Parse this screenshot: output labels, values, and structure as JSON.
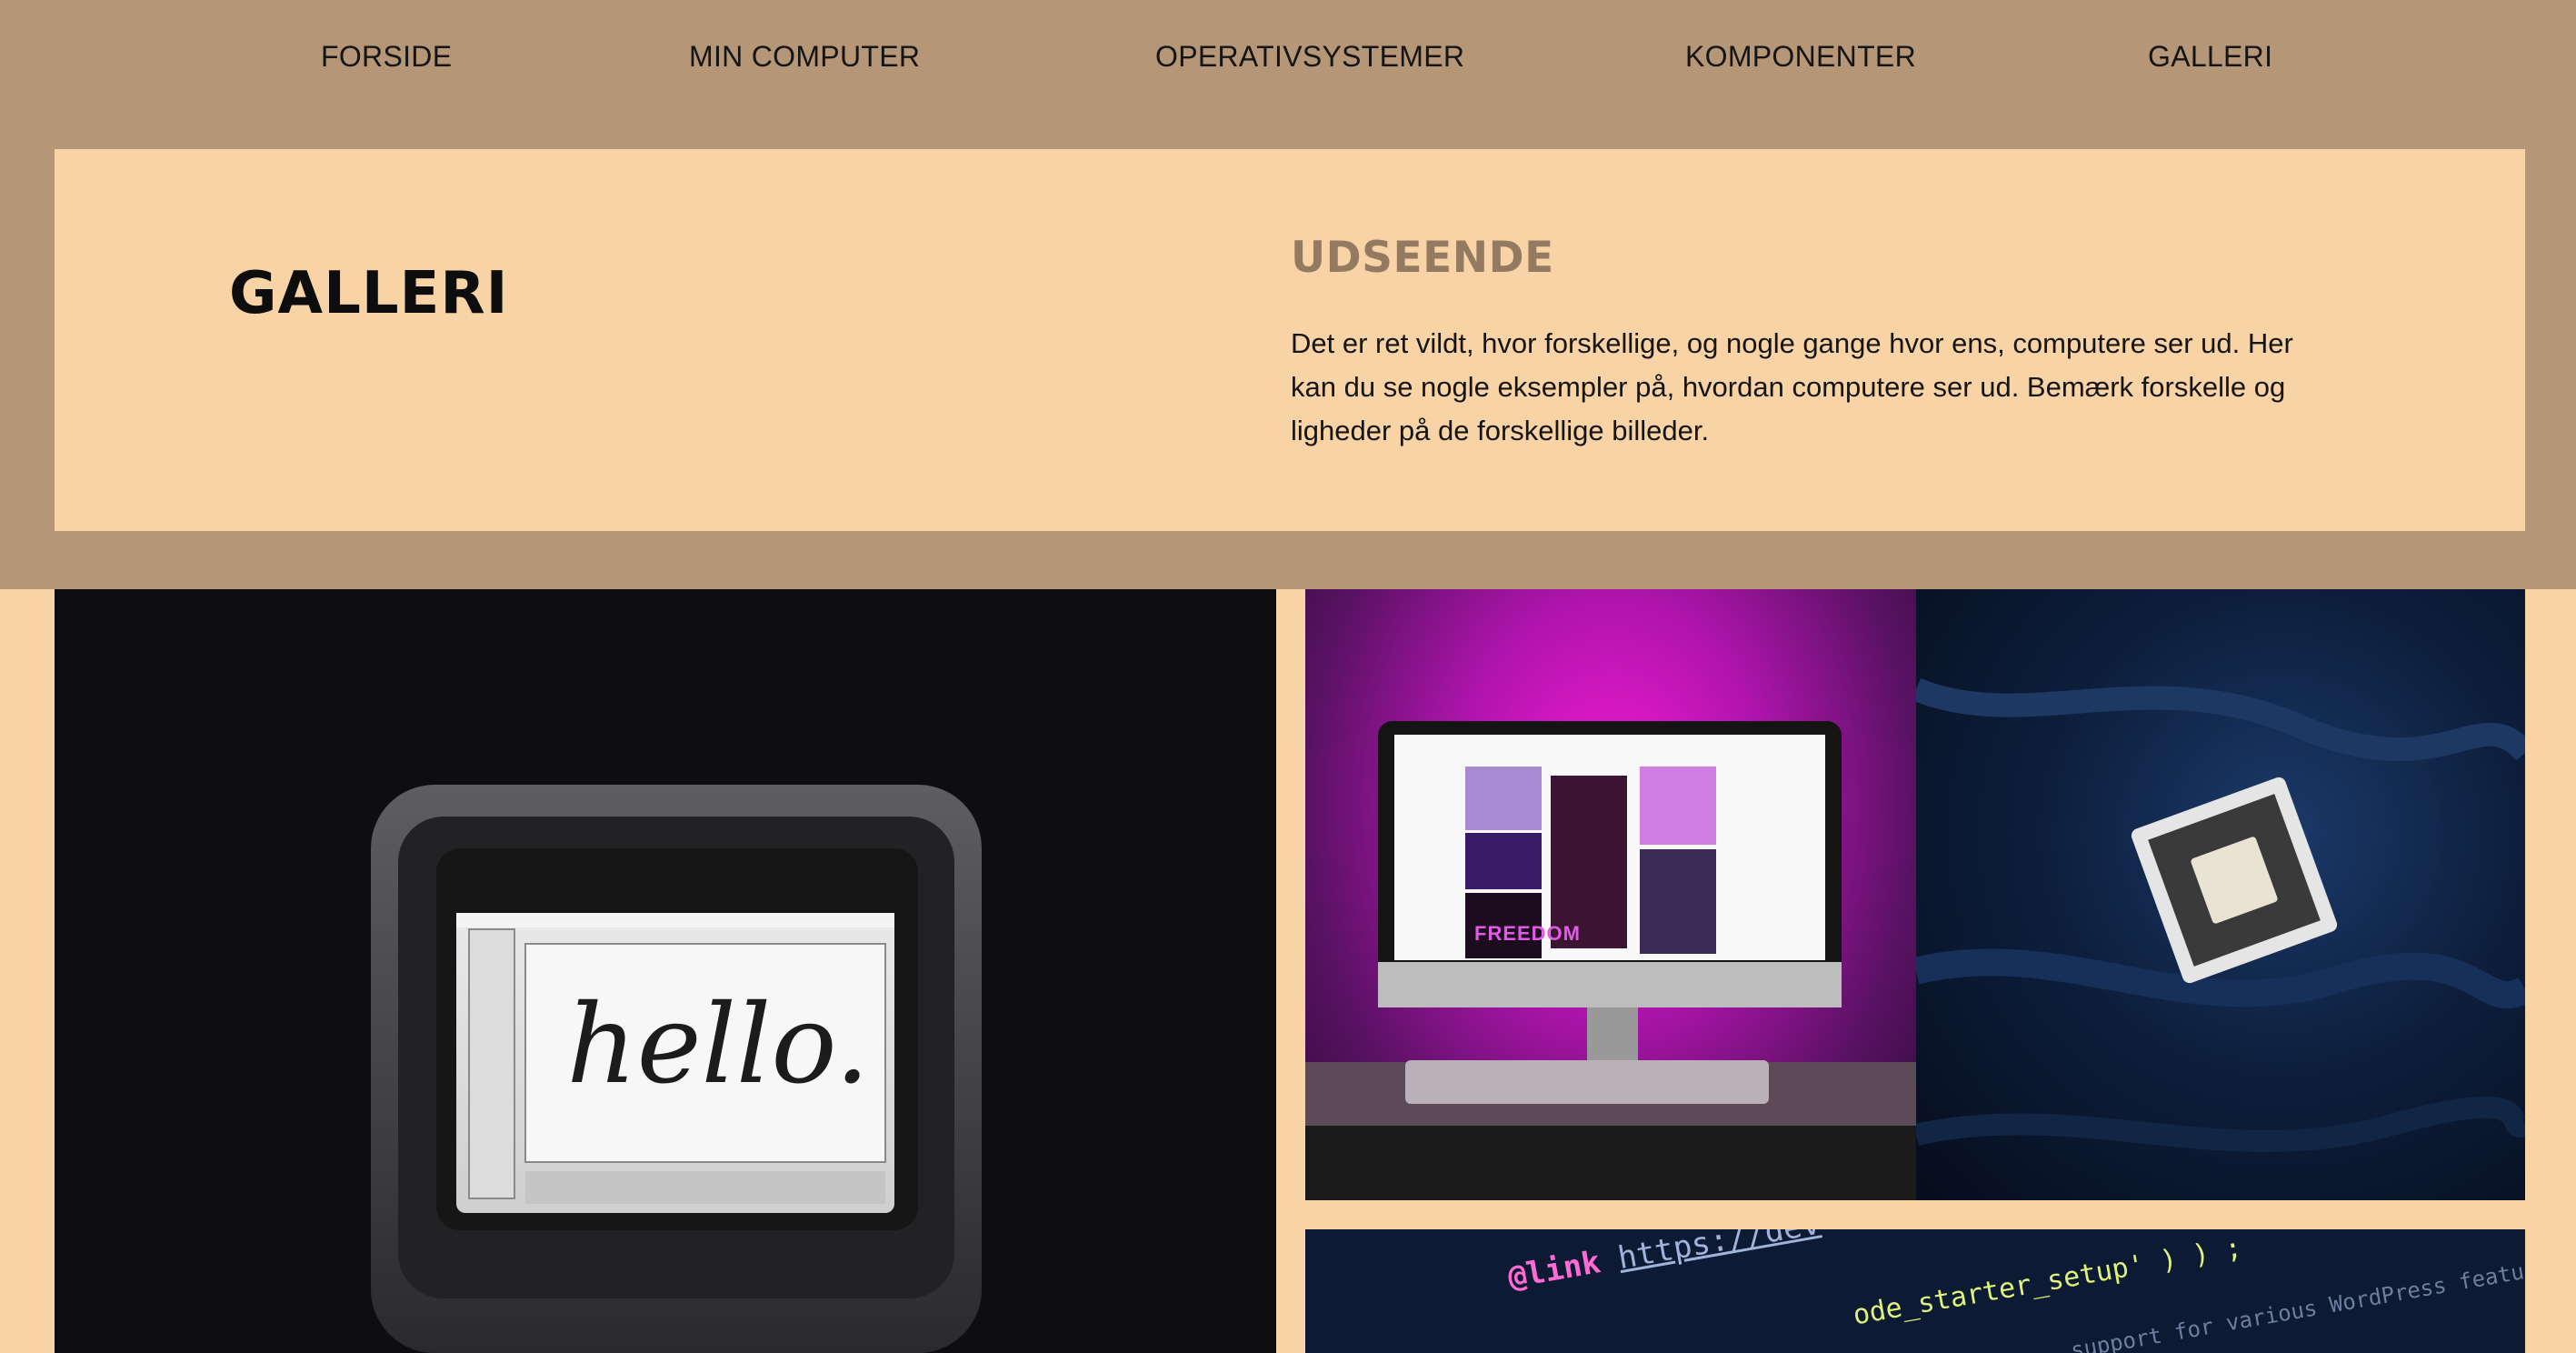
{
  "nav": {
    "items": [
      "FORSIDE",
      "MIN COMPUTER",
      "OPERATIVSYSTEMER",
      "KOMPONENTER",
      "GALLERI"
    ]
  },
  "hero": {
    "title": "GALLERI",
    "subtitle": "UDSEENDE",
    "description": "Det er ret vildt, hvor forskellige, og nogle gange hvor ens, computere ser ud. Her kan du se nogle eksempler på, hvordan computere ser ud. Bemærk forskelle og ligheder på de forskellige billeder."
  },
  "gallery": {
    "mac_screen_text": "hello.",
    "pink_screen_text": "FREEDOM",
    "code_snippet": {
      "line1_keyword": "@link",
      "line1_url": "https://dev",
      "line1_tail": "ode_starter_setup' ) ) ;",
      "line2_comment": "support for various WordPress features, which"
    }
  },
  "colors": {
    "band": "#b59777",
    "panel": "#f8d3a5",
    "subtitle": "#957a62",
    "text": "#151515"
  }
}
